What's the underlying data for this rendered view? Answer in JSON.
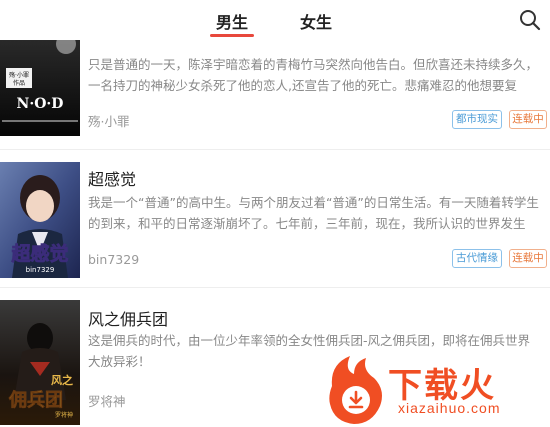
{
  "tabs": [
    {
      "label": "男生",
      "active": true
    },
    {
      "label": "女生",
      "active": false
    }
  ],
  "books": [
    {
      "title": "",
      "description": "只是普通的一天，陈泽宇暗恋着的青梅竹马突然向他告白。但欣喜还未持续多久，一名持刀的神秘少女杀死了他的恋人,还宣告了他的死亡。悲痛难忍的他想要复仇…",
      "author": "殇·小罪",
      "tags": [
        "都市现实",
        "连载中"
      ],
      "cover_text": [
        "殇·小罪",
        "作品",
        "N·O·D"
      ]
    },
    {
      "title": "超感觉",
      "description": "我是一个“普通”的高中生。与两个朋友过着“普通”的日常生活。有一天随着转学生的到来，和平的日常逐渐崩坏了。七年前，三年前，现在，我所认识的世界发生了…",
      "author": "bin7329",
      "tags": [
        "古代情缘",
        "连载中"
      ],
      "cover_text": [
        "超感觉",
        "bin7329"
      ]
    },
    {
      "title": "风之佣兵团",
      "description": "这是佣兵的时代，由一位少年率领的全女性佣兵团-风之佣兵团，即将在佣兵世界大放异彩！",
      "author": "罗将神",
      "tags": [],
      "cover_text": [
        "风之",
        "佣兵团",
        "罗将神"
      ]
    }
  ],
  "watermark": {
    "brand": "下载火",
    "url": "xiazaihuo.com"
  },
  "colors": {
    "accent": "#e8483c",
    "tag_blue": "#4a9bd6",
    "tag_red": "#e8793c",
    "watermark": "#f04e23"
  }
}
